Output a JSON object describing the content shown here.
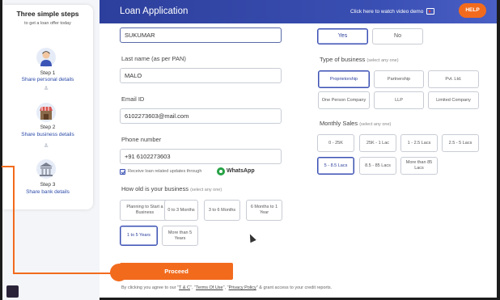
{
  "sidebar": {
    "title": "Three simple steps",
    "subtitle": "to get a loan offer today",
    "steps": [
      {
        "num": "Step 1",
        "link": "Share personal details",
        "icon": "person-icon"
      },
      {
        "num": "Step 2",
        "link": "Share business details",
        "icon": "shop-icon"
      },
      {
        "num": "Step 3",
        "link": "Share bank details",
        "icon": "bank-icon"
      }
    ],
    "chevron": "≚"
  },
  "header": {
    "title": "Loan Application",
    "video_link": "Click here to watch video demo",
    "help": "HELP"
  },
  "form": {
    "first_name_value": "SUKUMAR",
    "last_name_label": "Last name (as per PAN)",
    "last_name_value": "MALO",
    "email_label": "Email ID",
    "email_value": "6102273603@mail.com",
    "phone_label": "Phone number",
    "phone_value": "+91  6102273603",
    "whatsapp_label": "Receive loan related updates through",
    "whatsapp": "WhatsApp",
    "age_label": "How old is your business",
    "age_hint": "(select any one)",
    "age_options": [
      "Planning to Start a Business",
      "0 to 3 Months",
      "3 to 6 Months",
      "6 Months to 1 Year",
      "1 to 5 Years",
      "More than 5 Years"
    ],
    "age_selected": "1 to 5 Years",
    "yes": "Yes",
    "no": "No",
    "type_label": "Type of business",
    "type_hint": "(select any one)",
    "type_options": [
      "Proprietorship",
      "Partnership",
      "Pvt. Ltd.",
      "One Person Company",
      "LLP",
      "Limited Company"
    ],
    "type_selected": "Proprietorship",
    "sales_label": "Monthly Sales",
    "sales_hint": "(select any one)",
    "sales_options": [
      "0 - 25K",
      "25K - 1 Lac",
      "1 - 2.5 Lacs",
      "2.5 - 5 Lacs",
      "5 - 8.5 Lacs",
      "8.5 - 85 Lacs",
      "More than 85 Lacs"
    ],
    "sales_selected": "5 - 8.5 Lacs",
    "proceed": "Proceed",
    "terms_prefix": "By clicking you agree to our \"",
    "terms_tc": "T & C",
    "terms_mid1": "\", \"",
    "terms_use": "Terms Of Use",
    "terms_mid2": "\", \"",
    "terms_privacy": "Privacy Policy",
    "terms_suffix": "\" & grant access to your credit reports."
  },
  "colors": {
    "brand": "#2d3f9c",
    "accent": "#f26b1d",
    "whatsapp": "#25a244"
  }
}
